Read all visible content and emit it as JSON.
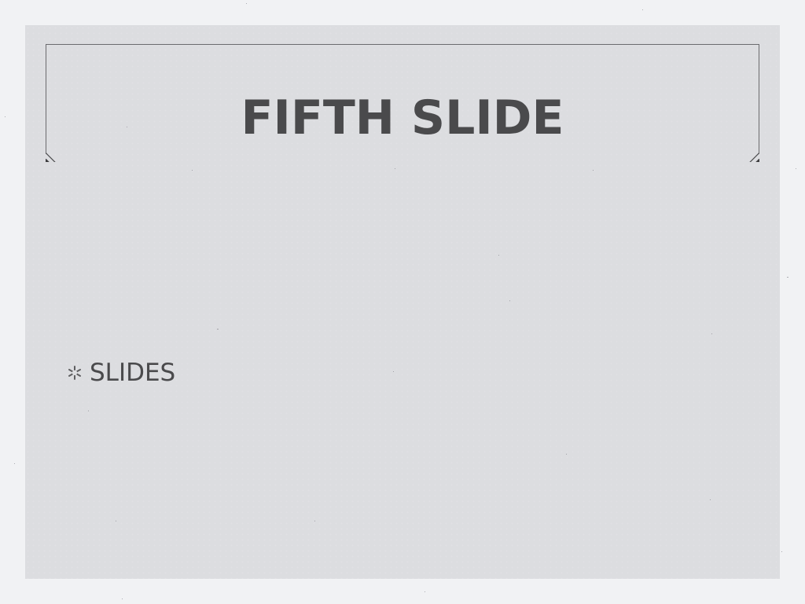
{
  "slide": {
    "title": "FIFTH SLIDE",
    "bullets": [
      {
        "text": "SLIDES",
        "icon": "asterisk-bullet-icon"
      }
    ]
  },
  "colors": {
    "background": "#f1f2f4",
    "slide_background": "#dcdde0",
    "text": "#4a4a4c",
    "frame_line": "#6b6b6e"
  }
}
